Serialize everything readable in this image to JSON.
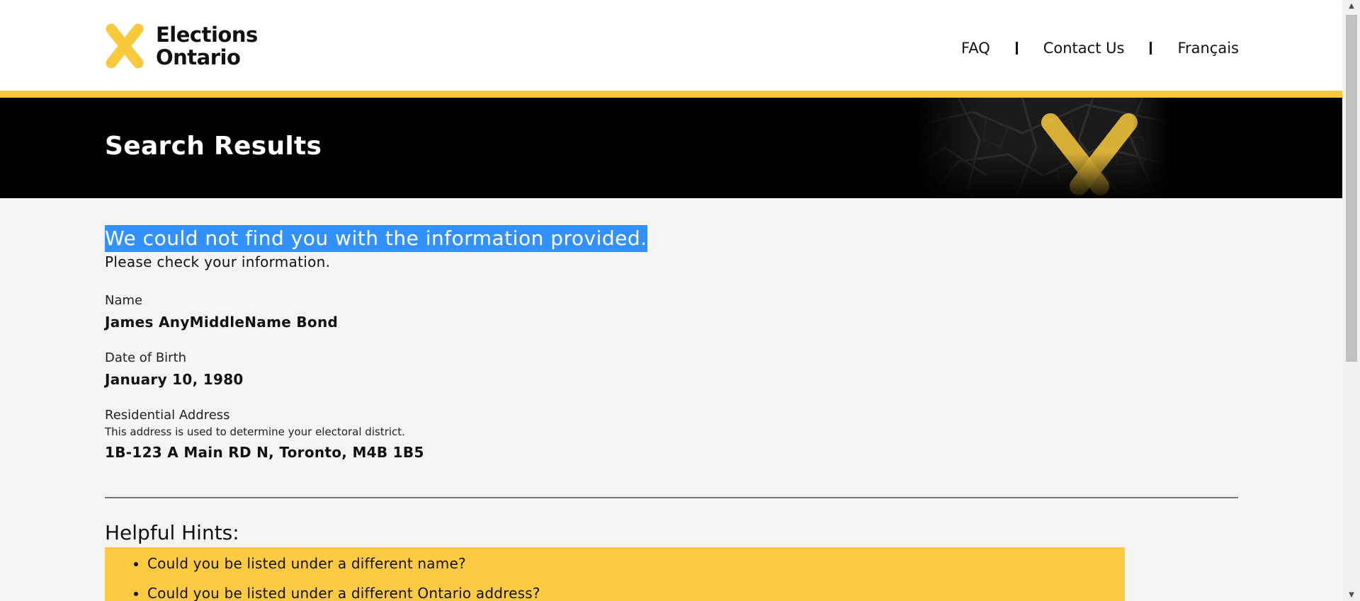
{
  "header": {
    "logo_line1": "Elections",
    "logo_line2": "Ontario",
    "nav": {
      "faq": "FAQ",
      "contact": "Contact Us",
      "french": "Français"
    }
  },
  "banner": {
    "title": "Search Results"
  },
  "result": {
    "message": "We could not find you with the information provided.",
    "sub": "Please check your information."
  },
  "fields": {
    "name_label": "Name",
    "name_value": "James AnyMiddleName Bond",
    "dob_label": "Date of Birth",
    "dob_value": "January 10, 1980",
    "address_label": "Residential Address",
    "address_note": "This address is used to determine your electoral district.",
    "address_value": "1B-123 A Main RD N, Toronto, M4B 1B5"
  },
  "hints": {
    "title": "Helpful Hints:",
    "items": [
      "Could you be listed under a different name?",
      "Could you be listed under a different Ontario address?"
    ]
  },
  "colors": {
    "brand_yellow": "#f8c93b",
    "hint_background": "#fdcb42",
    "banner_background": "#000000",
    "selection_highlight": "#3390ff"
  },
  "icons": {
    "logo": "elections-ontario-x-logo",
    "banner": "map-x-graphic"
  }
}
